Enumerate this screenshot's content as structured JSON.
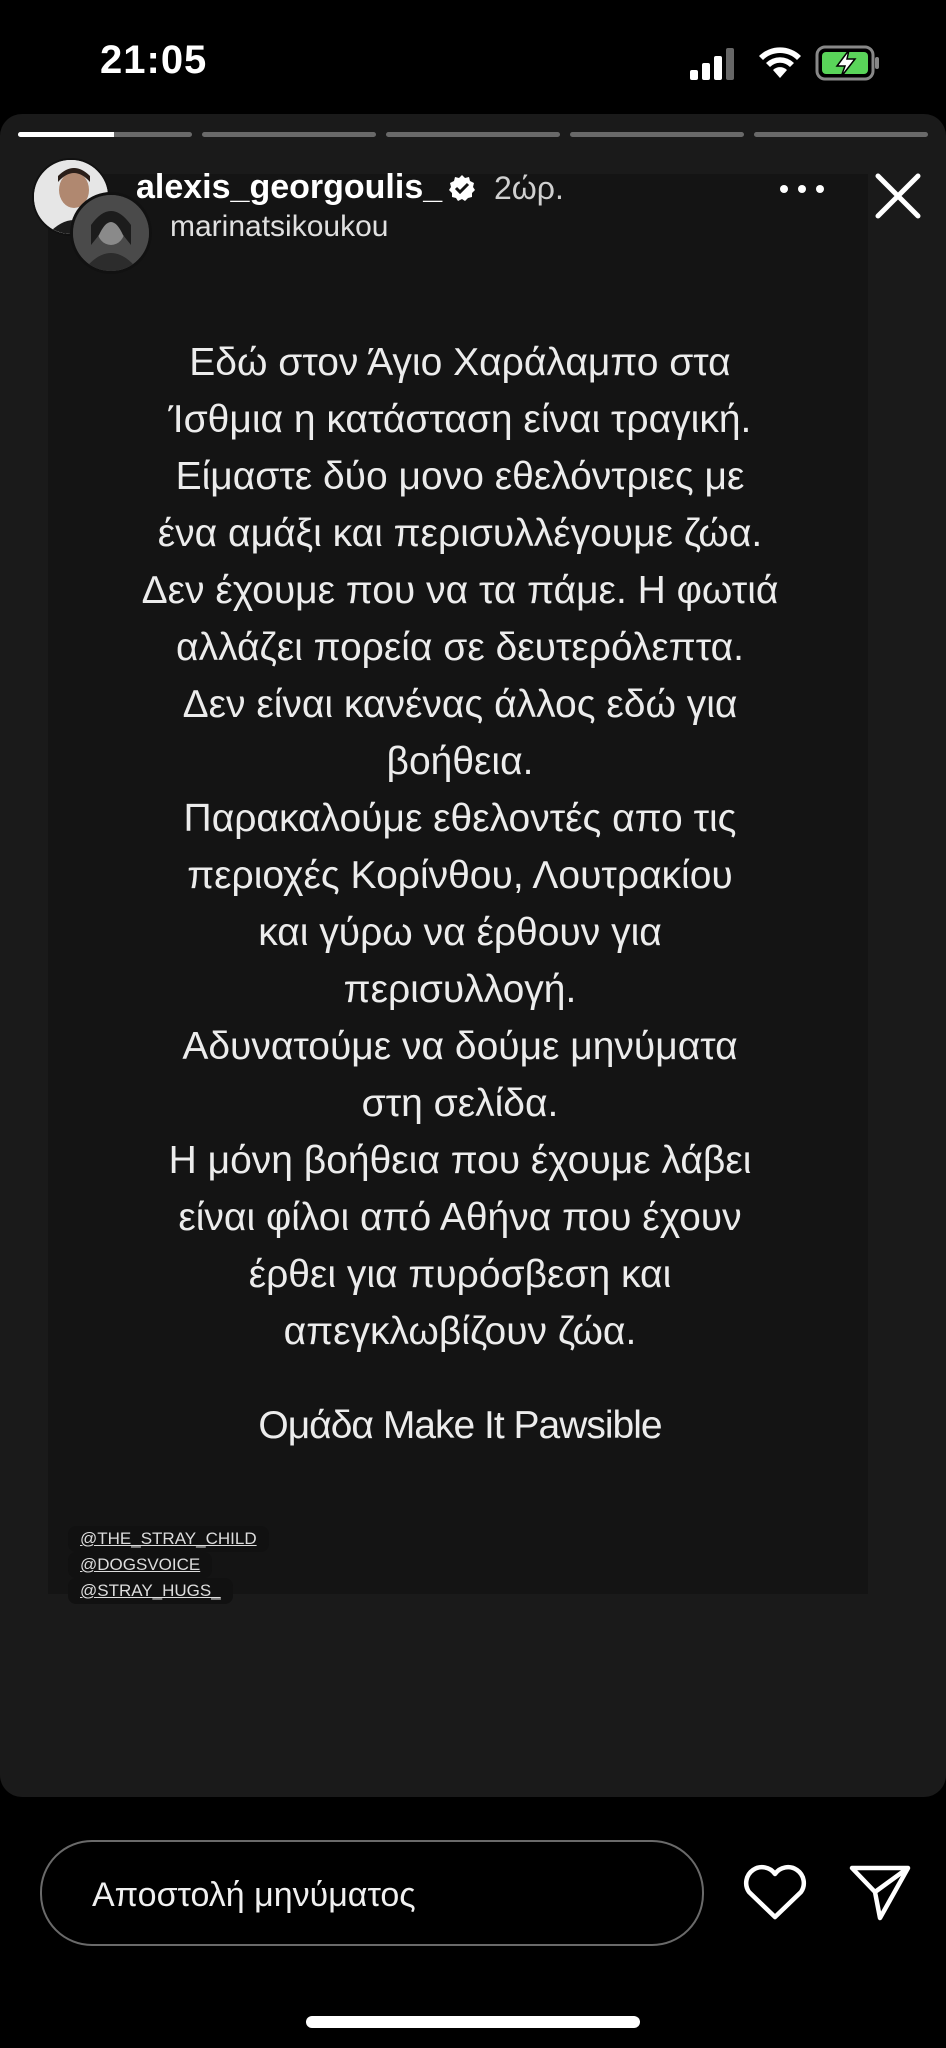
{
  "status_bar": {
    "time": "21:05",
    "icons": [
      "signal-icon",
      "wifi-icon",
      "battery-charging-icon"
    ],
    "battery_color": "#5ad55a"
  },
  "story": {
    "progress": {
      "segments": 5,
      "active_index": 0,
      "active_fraction": 0.55
    },
    "header": {
      "username": "alexis_georgoulis_",
      "verified": true,
      "time_ago": "2ώρ.",
      "shared_from": "marinatsikoukou"
    },
    "body_lines": [
      "Εδώ στον Άγιο Χαράλαμπο στα",
      "Ίσθμια η κατάσταση είναι τραγική.",
      "Είμαστε δύο μονο εθελόντριες με",
      "ένα αμάξι και περισυλλέγουμε ζώα.",
      "Δεν έχουμε που να τα πάμε. Η φωτιά",
      "αλλάζει πορεία σε δευτερόλεπτα.",
      "Δεν είναι κανένας άλλος εδώ για",
      "βοήθεια.",
      "Παρακαλούμε εθελοντές απο τις",
      "περιοχές Κορίνθου, Λουτρακίου",
      "και γύρω να έρθουν για",
      "περισυλλογή.",
      "Αδυνατούμε να δούμε μηνύματα",
      "στη σελίδα.",
      "Η μόνη βοήθεια που έχουμε λάβει",
      "είναι φίλοι από Αθήνα που έχουν",
      "έρθει για πυρόσβεση και",
      "απεγκλωβίζουν ζώα."
    ],
    "signature": "Ομάδα Make It Pawsible",
    "mentions": [
      "@THE_STRAY_CHILD",
      "@DOGSVOICE",
      "@STRAY_HUGS_"
    ]
  },
  "footer": {
    "reply_placeholder": "Αποστολή μηνύματος",
    "icons": [
      "heart-icon",
      "send-icon"
    ]
  },
  "colors": {
    "background": "#000000",
    "story_bg": "#1a1a1a",
    "text": "#ffffff"
  }
}
